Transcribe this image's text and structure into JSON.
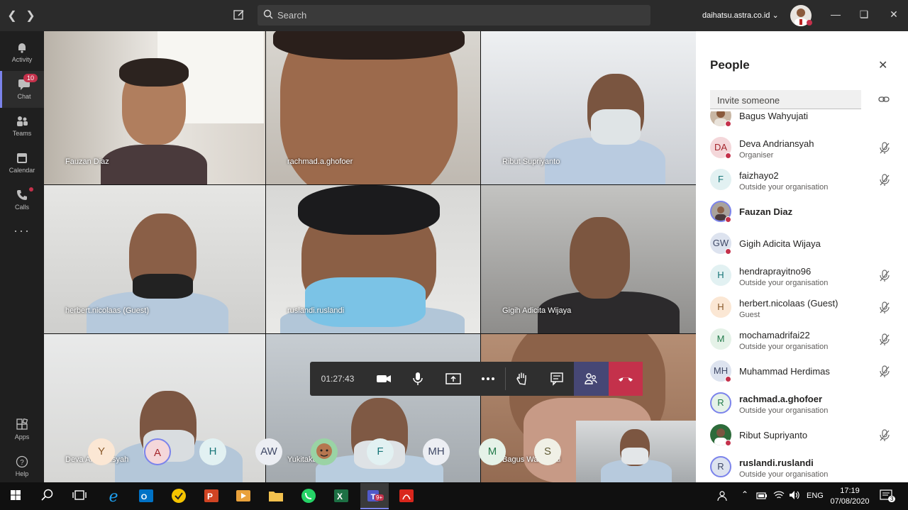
{
  "search": {
    "placeholder": "Search"
  },
  "account": {
    "org": "daihatsu.astra.co.id"
  },
  "rail": {
    "items": [
      {
        "label": "Activity",
        "icon": "bell-icon"
      },
      {
        "label": "Chat",
        "icon": "chat-icon",
        "badge": "10"
      },
      {
        "label": "Teams",
        "icon": "teams-icon"
      },
      {
        "label": "Calendar",
        "icon": "calendar-icon"
      },
      {
        "label": "Calls",
        "icon": "phone-icon"
      },
      {
        "label": "Apps",
        "icon": "apps-icon"
      },
      {
        "label": "Help",
        "icon": "help-icon"
      }
    ]
  },
  "meeting": {
    "timer": "01:27:43",
    "tiles": [
      {
        "name": "Fauzan Diaz"
      },
      {
        "name": "rachmad.a.ghofoer"
      },
      {
        "name": "Ribut Supriyanto"
      },
      {
        "name": "herbert.nicolaas (Guest)"
      },
      {
        "name": "ruslandi.ruslandi"
      },
      {
        "name": "Gigih Adicita Wijaya"
      },
      {
        "name": "Deva Andriansyah"
      },
      {
        "name": "Yukitaka"
      },
      {
        "name": "Bagus Wahyujati"
      }
    ],
    "avatars": [
      "Y",
      "A",
      "H",
      "AW",
      "",
      "F",
      "MH",
      "M",
      "S"
    ]
  },
  "people": {
    "title": "People",
    "invite_placeholder": "Invite someone",
    "list": [
      {
        "name": "Bagus Wahyujati",
        "role": "",
        "initials": ""
      },
      {
        "name": "Deva Andriansyah",
        "role": "Organiser",
        "initials": "DA"
      },
      {
        "name": "faizhayo2",
        "role": "Outside your organisation",
        "initials": "F"
      },
      {
        "name": "Fauzan Diaz",
        "role": "",
        "initials": ""
      },
      {
        "name": "Gigih Adicita Wijaya",
        "role": "",
        "initials": "GW"
      },
      {
        "name": "hendraprayitno96",
        "role": "Outside your organisation",
        "initials": "H"
      },
      {
        "name": "herbert.nicolaas (Guest)",
        "role": "Guest",
        "initials": "H"
      },
      {
        "name": "mochamadrifai22",
        "role": "Outside your organisation",
        "initials": "M"
      },
      {
        "name": "Muhammad Herdimas",
        "role": "",
        "initials": "MH"
      },
      {
        "name": "rachmad.a.ghofoer",
        "role": "Outside your organisation",
        "initials": "R"
      },
      {
        "name": "Ribut Supriyanto",
        "role": "",
        "initials": ""
      },
      {
        "name": "ruslandi.ruslandi",
        "role": "Outside your organisation",
        "initials": "R"
      }
    ]
  },
  "taskbar": {
    "lang": "ENG",
    "time": "17:19",
    "date": "07/08/2020",
    "notifications": "3",
    "teams_badge": "9+"
  }
}
